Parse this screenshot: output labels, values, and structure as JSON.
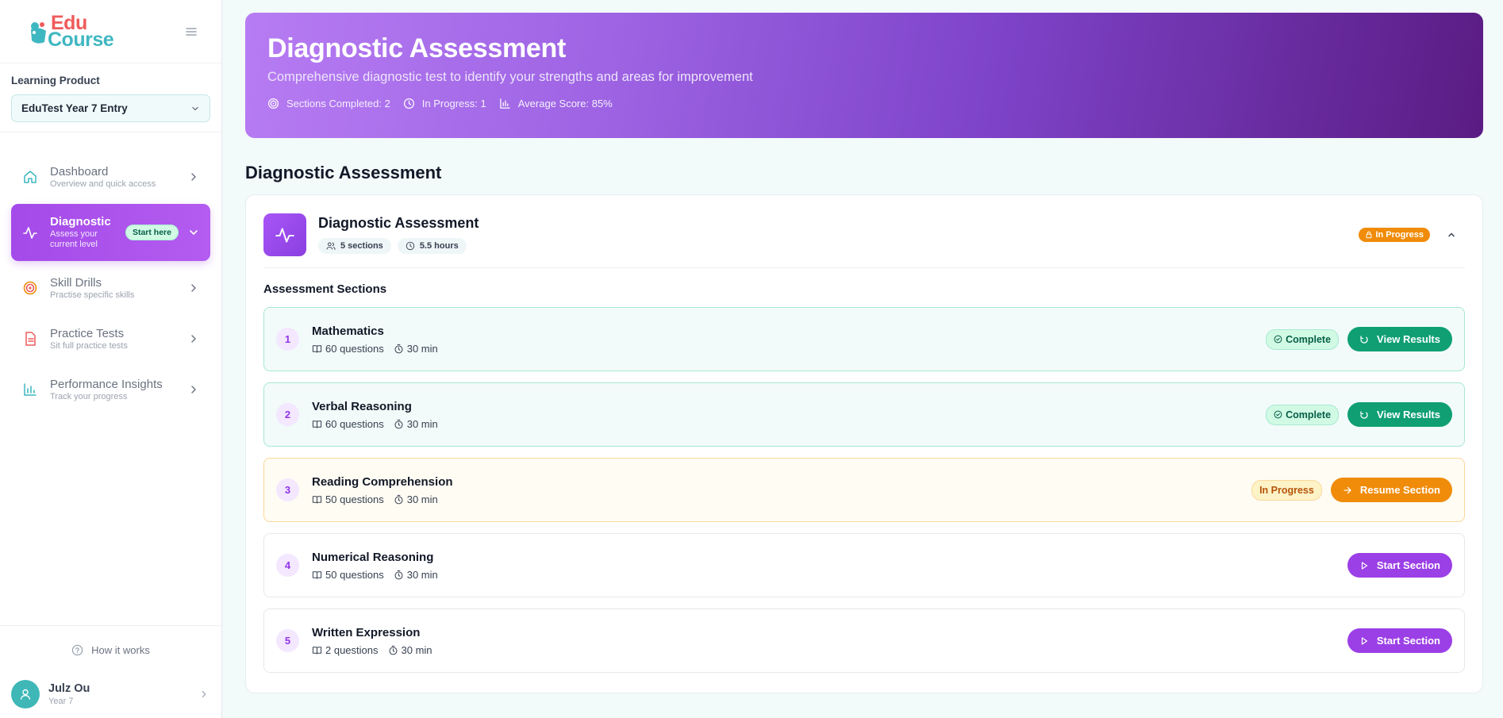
{
  "brand": {
    "line1": "Edu",
    "line2": "Course"
  },
  "sidebar": {
    "product_label": "Learning Product",
    "product_value": "EduTest Year 7 Entry",
    "items": [
      {
        "title": "Dashboard",
        "sub": "Overview and quick access",
        "icon": "home-icon"
      },
      {
        "title": "Diagnostic",
        "sub": "Assess your current level",
        "icon": "activity-icon",
        "badge": "Start here"
      },
      {
        "title": "Skill Drills",
        "sub": "Practise specific skills",
        "icon": "target-icon"
      },
      {
        "title": "Practice Tests",
        "sub": "Sit full practice tests",
        "icon": "document-icon"
      },
      {
        "title": "Performance Insights",
        "sub": "Track your progress",
        "icon": "bar-chart-icon"
      }
    ],
    "how_it_works": "How it works",
    "user": {
      "name": "Julz Ou",
      "year": "Year 7"
    }
  },
  "hero": {
    "title": "Diagnostic Assessment",
    "subtitle": "Comprehensive diagnostic test to identify your strengths and areas for improvement",
    "stats": {
      "completed": "Sections Completed: 2",
      "in_progress": "In Progress: 1",
      "average": "Average Score: 85%"
    }
  },
  "main": {
    "heading": "Diagnostic Assessment",
    "card": {
      "title": "Diagnostic Assessment",
      "sections_chip": "5 sections",
      "hours_chip": "5.5 hours",
      "status": "In Progress",
      "sections_heading": "Assessment Sections"
    },
    "sections": [
      {
        "num": "1",
        "title": "Mathematics",
        "questions": "60 questions",
        "time": "30 min",
        "status": "Complete",
        "action": "View Results"
      },
      {
        "num": "2",
        "title": "Verbal Reasoning",
        "questions": "60 questions",
        "time": "30 min",
        "status": "Complete",
        "action": "View Results"
      },
      {
        "num": "3",
        "title": "Reading Comprehension",
        "questions": "50 questions",
        "time": "30 min",
        "status": "In Progress",
        "action": "Resume Section"
      },
      {
        "num": "4",
        "title": "Numerical Reasoning",
        "questions": "50 questions",
        "time": "30 min",
        "action": "Start Section"
      },
      {
        "num": "5",
        "title": "Written Expression",
        "questions": "2 questions",
        "time": "30 min",
        "action": "Start Section"
      }
    ]
  },
  "colors": {
    "accent_purple": "#9b3fe6",
    "success_green": "#0f9f73",
    "warning_orange": "#f08c0a",
    "brand_teal": "#3fb7c1",
    "brand_red": "#ef5b5b"
  }
}
